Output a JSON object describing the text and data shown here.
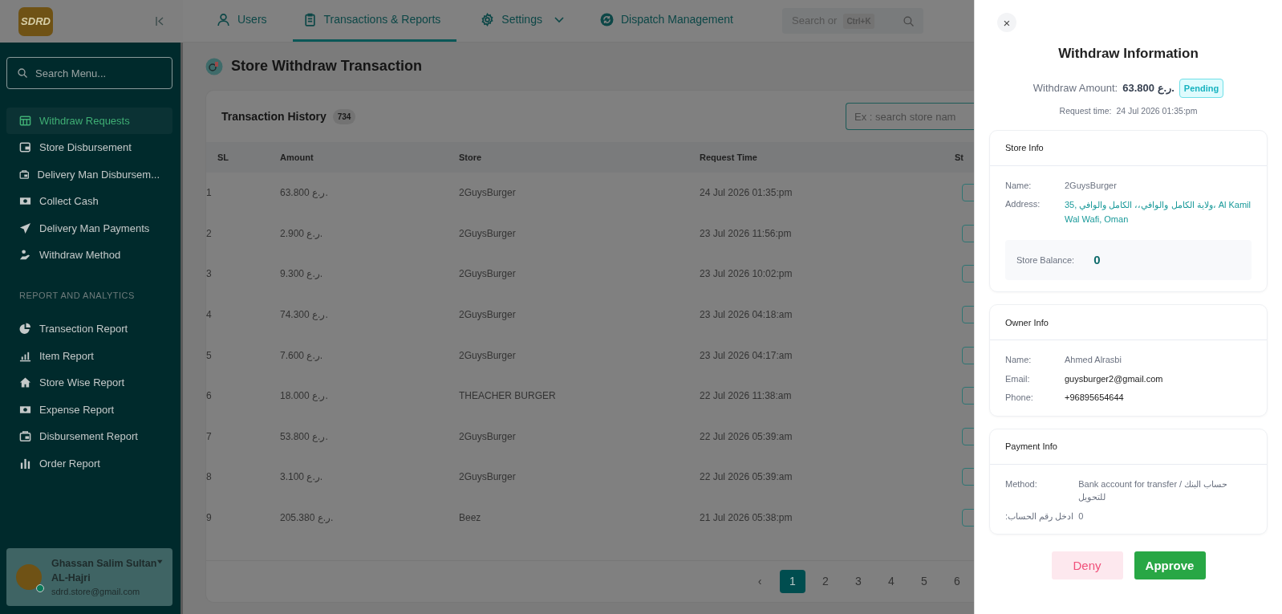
{
  "logo": {
    "text": "SDRD"
  },
  "topnav": [
    {
      "label": "Users",
      "selected": false
    },
    {
      "label": "Transactions & Reports",
      "selected": true
    },
    {
      "label": "Settings",
      "selected": false
    },
    {
      "label": "Dispatch Management",
      "selected": false
    }
  ],
  "topbar_search": {
    "placeholder": "Search or",
    "shortcut": "Ctrl+K"
  },
  "sidebar": {
    "search_placeholder": "Search Menu...",
    "groups": [
      {
        "items": [
          {
            "label": "Withdraw Requests",
            "selected": true
          },
          {
            "label": "Store Disbursement",
            "selected": false
          },
          {
            "label": "Delivery Man Disbursem...",
            "selected": false
          },
          {
            "label": "Collect Cash",
            "selected": false
          },
          {
            "label": "Delivery Man Payments",
            "selected": false
          },
          {
            "label": "Withdraw Method",
            "selected": false
          }
        ]
      },
      {
        "heading": "REPORT AND ANALYTICS",
        "items": [
          {
            "label": "Transection Report",
            "selected": false
          },
          {
            "label": "Item Report",
            "selected": false
          },
          {
            "label": "Store Wise Report",
            "selected": false
          },
          {
            "label": "Expense Report",
            "selected": false
          },
          {
            "label": "Disbursement Report",
            "selected": false
          },
          {
            "label": "Order Report",
            "selected": false
          }
        ]
      }
    ]
  },
  "user": {
    "name": "Ghassan Salim Sultan AL-Hajri",
    "email": "sdrd.store@gmail.com",
    "online": true
  },
  "page": {
    "title": "Store Withdraw Transaction"
  },
  "transactions": {
    "title": "Transaction History",
    "count": "734",
    "search_placeholder": "Ex : search store nam",
    "columns": [
      "SL",
      "Amount",
      "Store",
      "Request Time",
      "St"
    ],
    "rows": [
      {
        "sl": "1",
        "amount": "63.800 ر.ع.",
        "store": "2GuysBurger",
        "time": "24 Jul 2026 01:35:pm"
      },
      {
        "sl": "2",
        "amount": "2.900 ر.ع.",
        "store": "2GuysBurger",
        "time": "23 Jul 2026 11:56:pm"
      },
      {
        "sl": "3",
        "amount": "9.300 ر.ع.",
        "store": "2GuysBurger",
        "time": "23 Jul 2026 10:02:pm"
      },
      {
        "sl": "4",
        "amount": "74.300 ر.ع.",
        "store": "2GuysBurger",
        "time": "23 Jul 2026 04:18:am"
      },
      {
        "sl": "5",
        "amount": "7.600 ر.ع.",
        "store": "2GuysBurger",
        "time": "23 Jul 2026 04:17:am"
      },
      {
        "sl": "6",
        "amount": "18.000 ر.ع.",
        "store": "THEACHER BURGER",
        "time": "22 Jul 2026 11:38:am"
      },
      {
        "sl": "7",
        "amount": "53.800 ر.ع.",
        "store": "2GuysBurger",
        "time": "22 Jul 2026 05:39:am"
      },
      {
        "sl": "8",
        "amount": "3.100 ر.ع.",
        "store": "2GuysBurger",
        "time": "22 Jul 2026 05:39:am"
      },
      {
        "sl": "9",
        "amount": "205.380 ر.ع.",
        "store": "Beez",
        "time": "21 Jul 2026 05:38:pm"
      }
    ],
    "pagination": {
      "prev": "‹",
      "pages": [
        {
          "label": "1",
          "selected": true
        },
        {
          "label": "2",
          "selected": false
        },
        {
          "label": "3",
          "selected": false
        },
        {
          "label": "4",
          "selected": false
        },
        {
          "label": "5",
          "selected": false
        },
        {
          "label": "6",
          "selected": false
        }
      ]
    }
  },
  "drawer": {
    "close": "×",
    "title": "Withdraw Information",
    "amount_label": "Withdraw Amount:",
    "amount": "63.800 ر.ع.",
    "status": "Pending",
    "request_label": "Request time:",
    "request_time": "24 Jul 2026 01:35:pm",
    "sections": [
      {
        "title": "Store Info",
        "fields": [
          {
            "label": "Name:",
            "value": "2GuysBurger",
            "kind": "muted"
          },
          {
            "label": "Address:",
            "value": "35, ولاية الكامل والوافي،، الكامل والوافي، Al Kamil Wal Wafi, Oman",
            "kind": "link"
          }
        ],
        "balance": {
          "label": "Store Balance:",
          "value": "0"
        }
      },
      {
        "title": "Owner Info",
        "fields": [
          {
            "label": "Name:",
            "value": "Ahmed Alrasbi",
            "kind": "muted"
          },
          {
            "label": "Email:",
            "value": "guysburger2@gmail.com",
            "kind": "plain"
          },
          {
            "label": "Phone:",
            "value": "+96895654644",
            "kind": "plain"
          }
        ]
      },
      {
        "title": "Payment Info",
        "fields": [
          {
            "label": "Method:",
            "value": "Bank account for transfer / حساب البنك للتحويل",
            "kind": "muted"
          },
          {
            "label": "ادخل رقم الحساب:",
            "value": "0",
            "kind": "muted"
          }
        ]
      }
    ],
    "buttons": [
      {
        "label": "Deny",
        "kind": "deny"
      },
      {
        "label": "Approve",
        "kind": "approve"
      }
    ]
  }
}
